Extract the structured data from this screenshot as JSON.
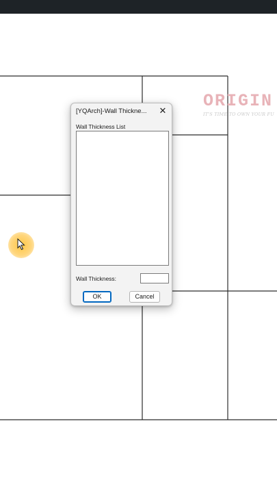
{
  "screen": {
    "top_bar_color": "#1e2327",
    "canvas_color": "#ffffff",
    "line_color": "#2b2b2b"
  },
  "watermark": {
    "logo_text": "ORIGIN",
    "tagline": "IT'S TIME TO OWN YOUR FU"
  },
  "dialog": {
    "title": "[YQArch]-Wall Thickne...",
    "close_icon": "close-icon",
    "list_label": "Wall Thickness List",
    "list_items": [],
    "field_label": "Wall Thickness:",
    "field_value": "",
    "ok_label": "OK",
    "cancel_label": "Cancel",
    "accent_color": "#0067c0"
  },
  "cursor": {
    "icon": "mouse-pointer-icon",
    "highlight_color": "#ffc43c"
  }
}
